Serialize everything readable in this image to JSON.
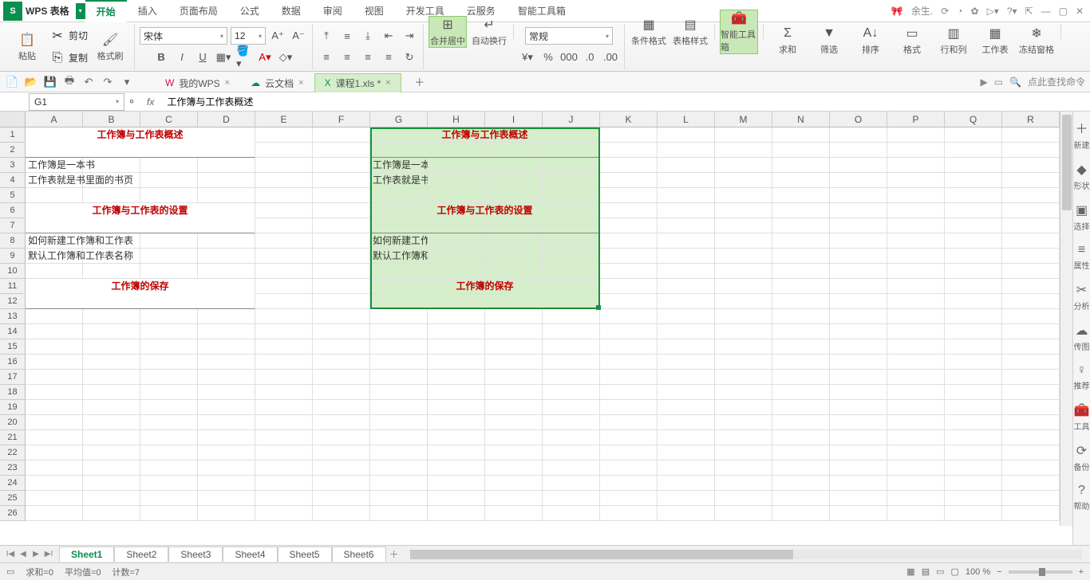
{
  "app": {
    "name": "WPS 表格"
  },
  "menu": [
    "开始",
    "插入",
    "页面布局",
    "公式",
    "数据",
    "审阅",
    "视图",
    "开发工具",
    "云服务",
    "智能工具箱"
  ],
  "menu_active": 0,
  "user": "余生.",
  "ribbon": {
    "paste": "粘贴",
    "cut": "剪切",
    "copy": "复制",
    "format_painter": "格式刷",
    "font_name": "宋体",
    "font_size": "12",
    "merge": "合并居中",
    "wrap": "自动换行",
    "number_format": "常规",
    "cond_fmt": "条件格式",
    "table_style": "表格样式",
    "smart_tools": "智能工具箱",
    "sum": "求和",
    "filter": "筛选",
    "sort": "排序",
    "format": "格式",
    "rowcol": "行和列",
    "worksheet": "工作表",
    "freeze": "冻结窗格"
  },
  "doc_tabs": [
    {
      "label": "我的WPS"
    },
    {
      "label": "云文档"
    },
    {
      "label": "课程1.xls *",
      "active": true
    }
  ],
  "search_hint": "点此查找命令",
  "namebox": "G1",
  "formula": "工作簿与工作表概述",
  "columns": [
    "A",
    "B",
    "C",
    "D",
    "E",
    "F",
    "G",
    "H",
    "I",
    "J",
    "K",
    "L",
    "M",
    "N",
    "O",
    "P",
    "Q",
    "R"
  ],
  "row_count": 26,
  "cells": {
    "titleA1": "工作簿与工作表概述",
    "A3": "工作簿是一本书",
    "A4": "工作表就是书里面的书页",
    "titleA6": "工作簿与工作表的设置",
    "A8": "如何新建工作簿和工作表",
    "A9": "默认工作簿和工作表名称",
    "titleA11": "工作簿的保存",
    "titleG1": "工作簿与工作表概述",
    "G3": "工作簿是一本书",
    "G4": "工作表就是书里面的书页",
    "titleG6": "工作簿与工作表的设置",
    "G8": "如何新建工作簿和工作表",
    "G9": "默认工作簿和工作表名称",
    "titleG11": "工作簿的保存"
  },
  "sheets": [
    "Sheet1",
    "Sheet2",
    "Sheet3",
    "Sheet4",
    "Sheet5",
    "Sheet6"
  ],
  "sheet_active": 0,
  "status": {
    "sum": "求和=0",
    "avg": "平均值=0",
    "count": "计数=7",
    "zoom": "100 %"
  },
  "sidepanel": [
    {
      "icon": "＋",
      "label": "新建"
    },
    {
      "icon": "◆",
      "label": "形状"
    },
    {
      "icon": "▣",
      "label": "选择"
    },
    {
      "icon": "≡",
      "label": "属性"
    },
    {
      "icon": "✂",
      "label": "分析"
    },
    {
      "icon": "☁",
      "label": "传图"
    },
    {
      "icon": "♀",
      "label": "推荐"
    },
    {
      "icon": "🧰",
      "label": "工具"
    },
    {
      "icon": "⟳",
      "label": "备份"
    },
    {
      "icon": "?",
      "label": "帮助"
    }
  ]
}
